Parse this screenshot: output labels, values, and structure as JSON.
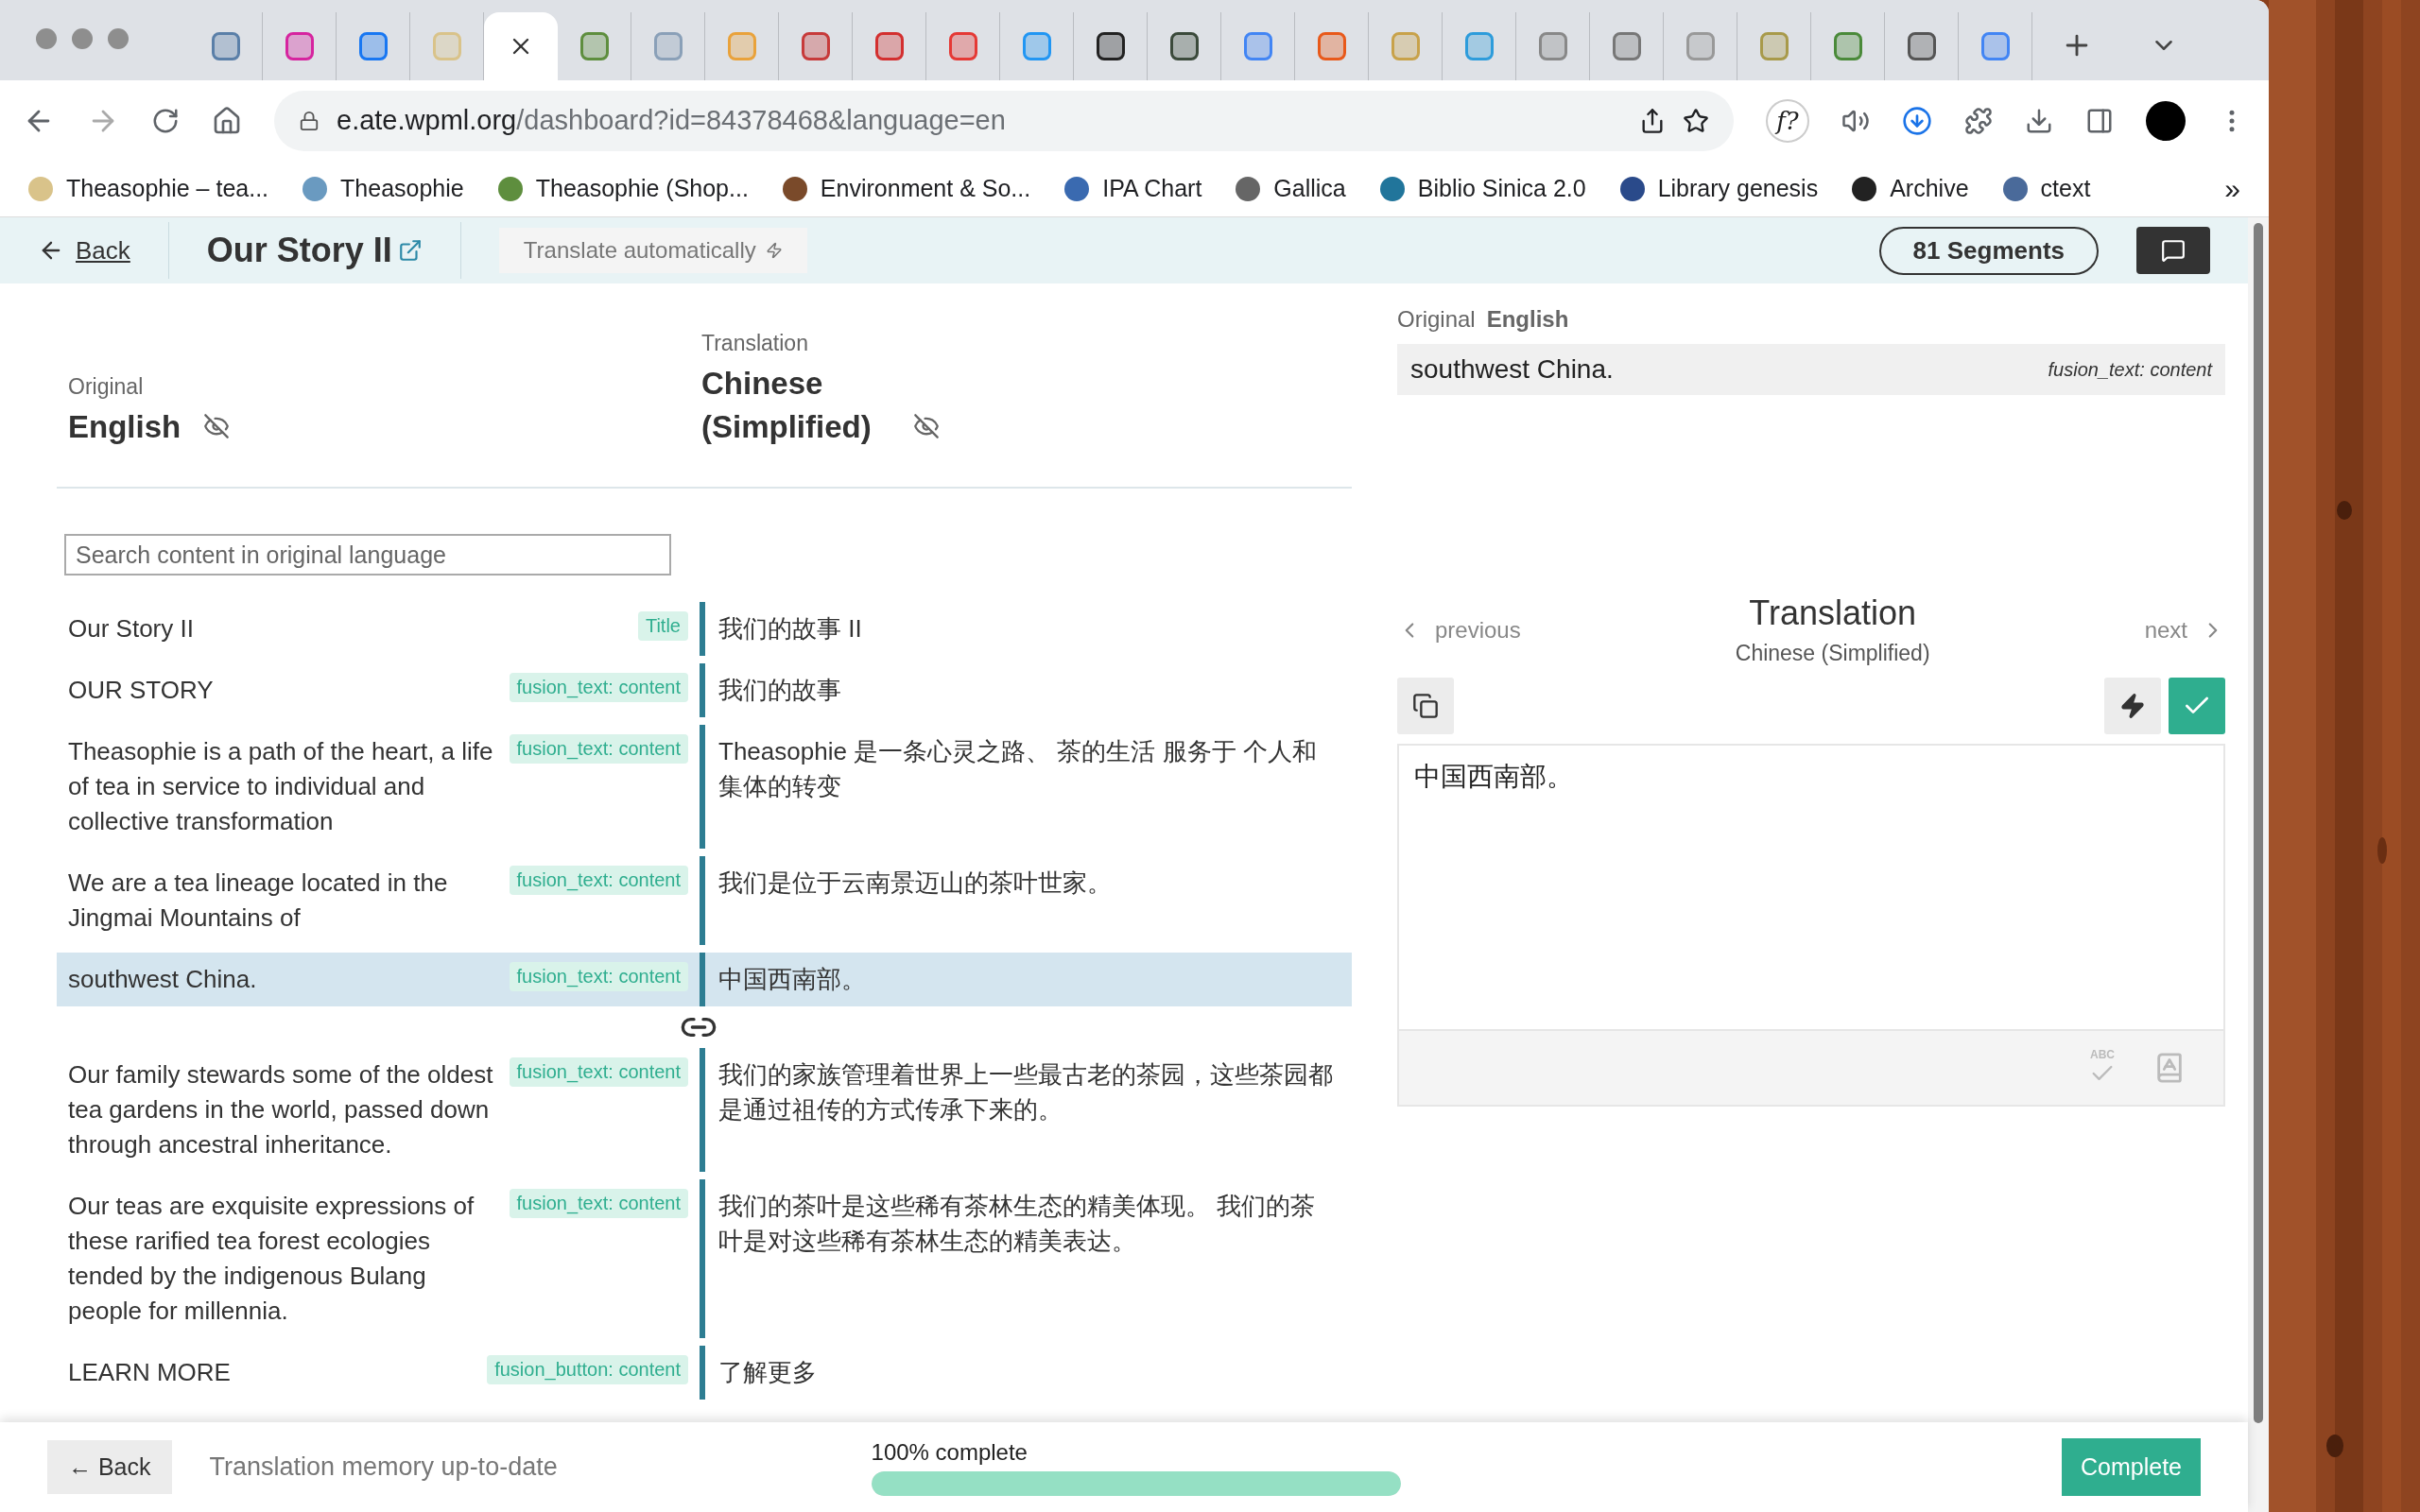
{
  "browser": {
    "tabs": [
      {
        "color": "#5a7fa8",
        "selected": false
      },
      {
        "color": "#d6249f",
        "selected": false
      },
      {
        "color": "#1877f2",
        "selected": false
      },
      {
        "color": "#d9c38a",
        "selected": false
      },
      {
        "selected": true
      },
      {
        "color": "#5e8e3e",
        "selected": false
      },
      {
        "color": "#8aa0b8",
        "selected": false
      },
      {
        "color": "#e9a23b",
        "selected": false
      },
      {
        "color": "#c73a3a",
        "selected": false
      },
      {
        "color": "#d32f2f",
        "selected": false
      },
      {
        "color": "#e53935",
        "selected": false
      },
      {
        "color": "#2196f3",
        "selected": false
      },
      {
        "color": "#222222",
        "selected": false
      },
      {
        "color": "#3b4a3b",
        "selected": false
      },
      {
        "color": "#4285f4",
        "selected": false
      },
      {
        "color": "#e8591a",
        "selected": false
      },
      {
        "color": "#c8a24a",
        "selected": false
      },
      {
        "color": "#2d9cdb",
        "selected": false
      },
      {
        "color": "#888888",
        "selected": false
      },
      {
        "color": "#777777",
        "selected": false
      },
      {
        "color": "#999999",
        "selected": false
      },
      {
        "color": "#a89a4a",
        "selected": false
      },
      {
        "color": "#4a8a3a",
        "selected": false
      },
      {
        "color": "#555555",
        "selected": false
      },
      {
        "color": "#4285f4",
        "selected": false
      }
    ],
    "address": {
      "host": "e.ate.wpml.org",
      "path": "/dashboard?id=84378468&language=en"
    },
    "extension_label": "f?",
    "bookmarks": [
      {
        "label": "Theasophie – tea...",
        "color": "#d9c38a"
      },
      {
        "label": "Theasophie",
        "color": "#6a9ac0"
      },
      {
        "label": "Theasophie (Shop...",
        "color": "#5e8e3e"
      },
      {
        "label": "Environment & So...",
        "color": "#7a4a2a"
      },
      {
        "label": "IPA Chart",
        "color": "#3a6ab0"
      },
      {
        "label": "Gallica",
        "color": "#666666"
      },
      {
        "label": "Biblio Sinica 2.0",
        "color": "#21759b"
      },
      {
        "label": "Library genesis",
        "color": "#2a4a8a"
      },
      {
        "label": "Archive",
        "color": "#222222"
      },
      {
        "label": "ctext",
        "color": "#4a6a9a"
      }
    ],
    "overflow": "»"
  },
  "header": {
    "back": "Back",
    "title": "Our Story II",
    "translate": "Translate automatically",
    "segments": "81 Segments"
  },
  "languages": {
    "original": {
      "caption": "Original",
      "name": "English"
    },
    "translation": {
      "caption": "Translation",
      "name": "Chinese (Simplified)"
    }
  },
  "search": {
    "placeholder": "Search content in original language"
  },
  "segments": [
    {
      "source": "Our Story II",
      "tag": "Title",
      "target": "我们的故事 II",
      "selected": false
    },
    {
      "source": "OUR STORY",
      "tag": "fusion_text: content",
      "target": "我们的故事",
      "selected": false
    },
    {
      "source": "Theasophie is a path of the heart, a life of tea in service to individual and collective transformation",
      "tag": "fusion_text: content",
      "target": "Theasophie 是一条心灵之路、 茶的生活 服务于 个人和集体的转变",
      "selected": false
    },
    {
      "source": "We are a tea lineage located in the Jingmai Mountains of",
      "tag": "fusion_text: content",
      "target": "我们是位于云南景迈山的茶叶世家。",
      "selected": false
    },
    {
      "source": "southwest China.",
      "tag": "fusion_text: content",
      "target": "中国西南部。",
      "selected": true,
      "linked_below": true
    },
    {
      "source": "Our family stewards some of the oldest tea gardens in the world, passed down through ancestral inheritance.",
      "tag": "fusion_text: content",
      "target": "我们的家族管理着世界上一些最古老的茶园，这些茶园都是通过祖传的方式传承下来的。",
      "selected": false
    },
    {
      "source": "Our teas are exquisite expressions of these rarified tea forest ecologies tended by the indigenous Bulang people for millennia.",
      "tag": "fusion_text: content",
      "target": "我们的茶叶是这些稀有茶林生态的精美体现。 我们的茶叶是对这些稀有茶林生态的精美表达。",
      "selected": false
    },
    {
      "source": "LEARN MORE",
      "tag": "fusion_button: content",
      "target": "了解更多",
      "selected": false
    }
  ],
  "editor": {
    "original_caption": "Original",
    "original_language": "English",
    "source": "southwest China.",
    "source_tag": "fusion_text: content",
    "previous": "previous",
    "next": "next",
    "title": "Translation",
    "language": "Chinese (Simplified)",
    "value": "中国西南部。",
    "spellcheck_label": "ABC"
  },
  "footer": {
    "back": "← Back",
    "status": "Translation memory up-to-date",
    "progress": {
      "label": "100% complete",
      "level": 1
    },
    "complete": "Complete"
  }
}
